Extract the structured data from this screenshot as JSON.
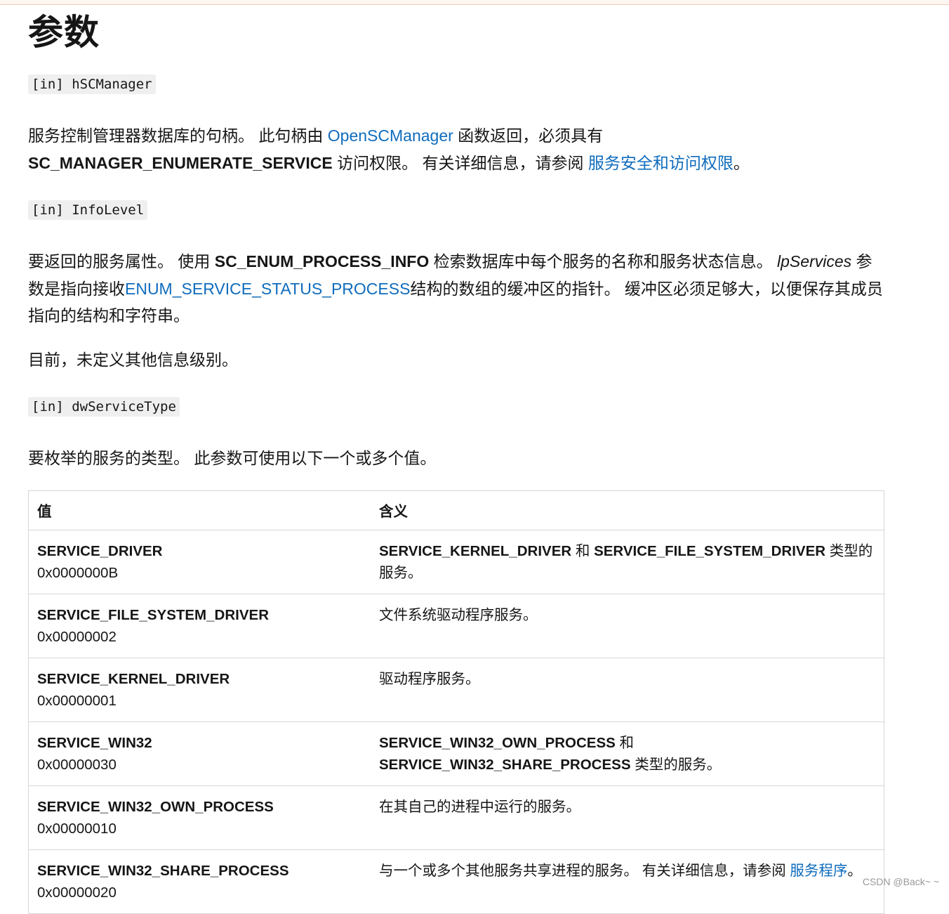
{
  "page": {
    "title": "参数",
    "watermark": "CSDN @Back~ ~"
  },
  "params": {
    "p1": {
      "chip": "[in] hSCManager",
      "t1": "服务控制管理器数据库的句柄。 此句柄由 ",
      "link1": "OpenSCManager",
      "t2": " 函数返回，必须具有",
      "b1": "SC_MANAGER_ENUMERATE_SERVICE",
      "t3": " 访问权限。 有关详细信息，请参阅 ",
      "link2": "服务安全和访问权限",
      "t4": "。"
    },
    "p2": {
      "chip": "[in] InfoLevel",
      "t1": "要返回的服务属性。 使用 ",
      "b1": "SC_ENUM_PROCESS_INFO",
      "t2": " 检索数据库中每个服务的名称和服务状态信息。 ",
      "i1": "lpServices",
      "t3": " 参数是指向接收",
      "link1": "ENUM_SERVICE_STATUS_PROCESS",
      "t4": "结构的数组的缓冲区的指针。 缓冲区必须足够大，以便保存其成员指向的结构和字符串。",
      "note": "目前，未定义其他信息级别。"
    },
    "p3": {
      "chip": "[in] dwServiceType",
      "text": "要枚举的服务的类型。 此参数可使用以下一个或多个值。"
    }
  },
  "table": {
    "headers": [
      "值",
      "含义"
    ],
    "rows": [
      {
        "name": "SERVICE_DRIVER",
        "hex": "0x0000000B",
        "m": {
          "b1": "SERVICE_KERNEL_DRIVER",
          "t1": " 和 ",
          "b2": "SERVICE_FILE_SYSTEM_DRIVER",
          "t2": " 类型的服务。"
        }
      },
      {
        "name": "SERVICE_FILE_SYSTEM_DRIVER",
        "hex": "0x00000002",
        "m": {
          "t1": "文件系统驱动程序服务。"
        }
      },
      {
        "name": "SERVICE_KERNEL_DRIVER",
        "hex": "0x00000001",
        "m": {
          "t1": "驱动程序服务。"
        }
      },
      {
        "name": "SERVICE_WIN32",
        "hex": "0x00000030",
        "m": {
          "b1": "SERVICE_WIN32_OWN_PROCESS",
          "t1": " 和 ",
          "b2": "SERVICE_WIN32_SHARE_PROCESS",
          "t2": " 类型的服务。"
        }
      },
      {
        "name": "SERVICE_WIN32_OWN_PROCESS",
        "hex": "0x00000010",
        "m": {
          "t1": "在其自己的进程中运行的服务。"
        }
      },
      {
        "name": "SERVICE_WIN32_SHARE_PROCESS",
        "hex": "0x00000020",
        "m": {
          "t1": "与一个或多个其他服务共享进程的服务。 有关详细信息，请参阅 ",
          "link": "服务程序",
          "t2": "。"
        }
      }
    ]
  }
}
